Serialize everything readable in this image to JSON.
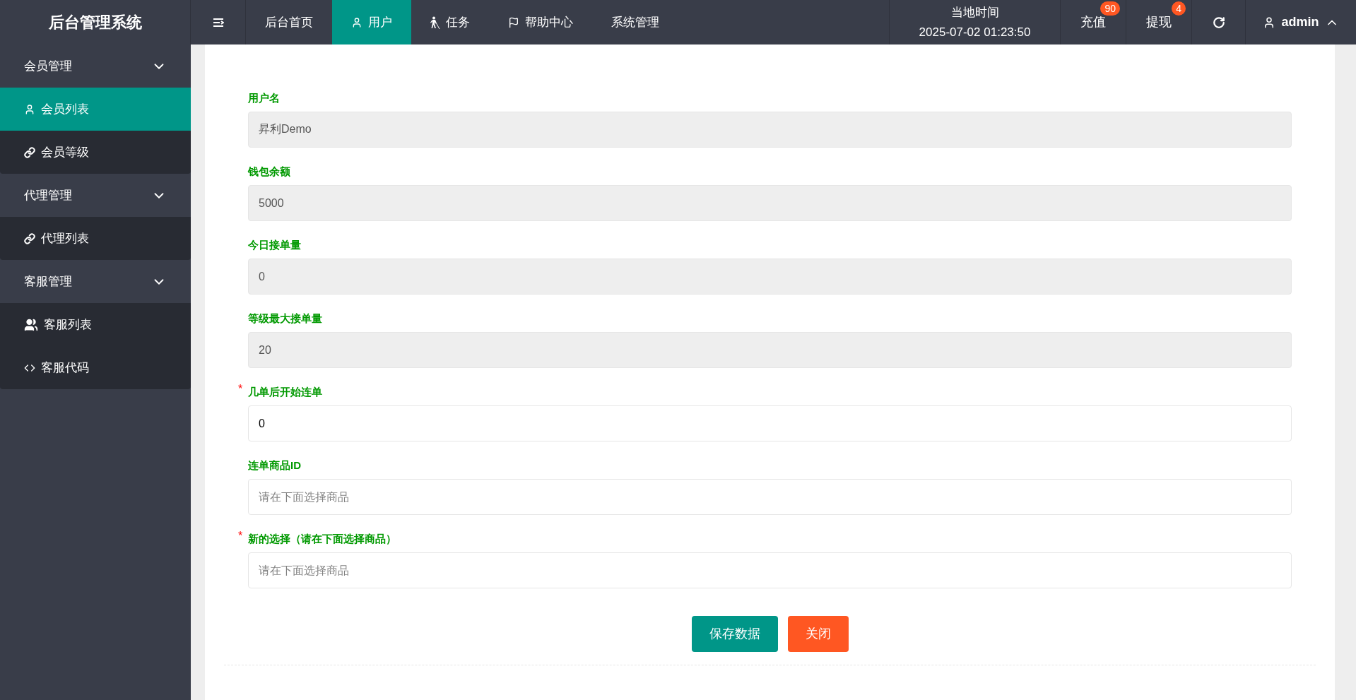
{
  "brand": "后台管理系统",
  "nav": [
    {
      "label": "后台首页",
      "kind": "plain",
      "selected": false
    },
    {
      "label": "用户",
      "kind": "user",
      "selected": true
    },
    {
      "label": "任务",
      "kind": "cane",
      "selected": false
    },
    {
      "label": "帮助中心",
      "kind": "flag",
      "selected": false
    },
    {
      "label": "系统管理",
      "kind": "plain",
      "selected": false
    }
  ],
  "clock": {
    "label": "当地时间",
    "time": "2025-07-02 01:23:50"
  },
  "actions": [
    {
      "label": "充值",
      "badge": "90"
    },
    {
      "label": "提现",
      "badge": "4"
    }
  ],
  "user": {
    "name": "admin",
    "expanded": true
  },
  "sidebar": [
    {
      "label": "会员管理",
      "expanded": true,
      "children": [
        {
          "label": "会员列表",
          "kind": "user",
          "selected": true
        },
        {
          "label": "会员等级",
          "kind": "link",
          "selected": false
        }
      ]
    },
    {
      "label": "代理管理",
      "expanded": true,
      "children": [
        {
          "label": "代理列表",
          "kind": "link",
          "selected": false
        }
      ]
    },
    {
      "label": "客服管理",
      "expanded": true,
      "children": [
        {
          "label": "客服列表",
          "kind": "users",
          "selected": false
        },
        {
          "label": "客服代码",
          "kind": "code",
          "selected": false
        }
      ]
    }
  ],
  "form": {
    "fields": [
      {
        "label": "用户名",
        "readonly": true,
        "value": "昇利Demo"
      },
      {
        "label": "钱包余额",
        "readonly": true,
        "value": "5000"
      },
      {
        "label": "今日接单量",
        "readonly": true,
        "value": "0"
      },
      {
        "label": "等级最大接单量",
        "readonly": true,
        "value": "20"
      },
      {
        "label": "几单后开始连单",
        "required_mark": "*",
        "readonly": false,
        "value": "0"
      },
      {
        "label": "连单商品ID",
        "readonly": false,
        "placeholder": "请在下面选择商品"
      },
      {
        "label": "新的选择（请在下面选择商品）",
        "required_mark": "*",
        "readonly": false,
        "placeholder": "请在下面选择商品"
      }
    ],
    "buttons": [
      {
        "label": "保存数据",
        "kind": "primary"
      },
      {
        "label": "关闭",
        "kind": "danger"
      }
    ]
  }
}
